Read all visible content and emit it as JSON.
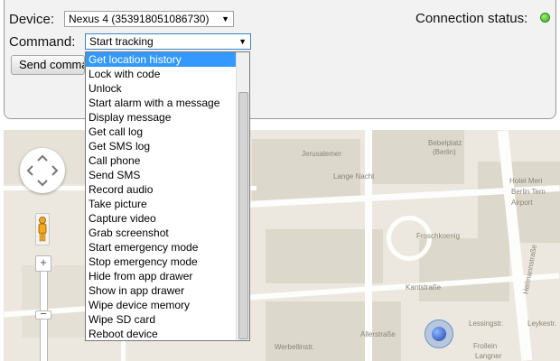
{
  "device": {
    "label": "Device:",
    "selected": "Nexus 4 (353918051086730)"
  },
  "connection": {
    "label": "Connection status:",
    "status_color": "#48c21e"
  },
  "command": {
    "label": "Command:",
    "selected": "Start tracking",
    "send_button_label": "Send comma",
    "options": [
      "Get location history",
      "Lock with code",
      "Unlock",
      "Start alarm with a message",
      "Display message",
      "Get call log",
      "Get SMS log",
      "Call phone",
      "Send SMS",
      "Record audio",
      "Take picture",
      "Capture video",
      "Grab screenshot",
      "Start emergency mode",
      "Stop emergency mode",
      "Hide from app drawer",
      "Show in app drawer",
      "Wipe device memory",
      "Wipe SD card",
      "Reboot device"
    ],
    "highlighted_option": "Get location history"
  },
  "map": {
    "labels": {
      "jerusalem": "Jerusalemer",
      "bebelplatz": "Bebelplatz",
      "lange_nacht": "Lange Nacht",
      "berlin": "(Berlin)",
      "hotel": "Hotel Meri",
      "berlin_tempel": "Berlin Tem",
      "airport": "Airport",
      "froschkoenig": "Froschkoenig",
      "kantstr": "Kantstraße",
      "allerstr": "Allerstraße",
      "lessingstr": "Lessingstr.",
      "langner": "Langner",
      "frollein": "Frollein",
      "hermannstr": "Hermannstraße",
      "leykestr": "Leykestr.",
      "werbellinstr": "Werbellinstr."
    },
    "zoom_in": "+",
    "zoom_out": "−"
  }
}
